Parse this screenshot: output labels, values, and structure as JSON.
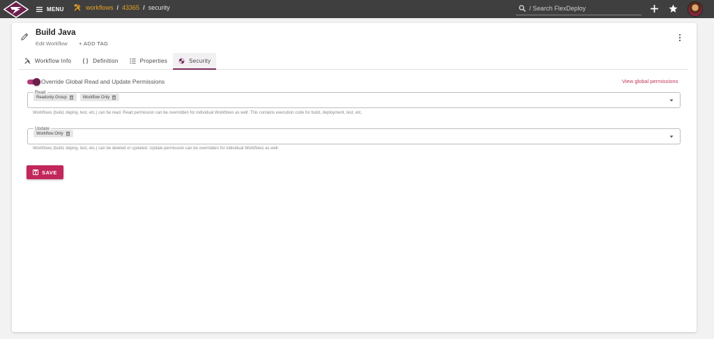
{
  "header": {
    "menu_label": "MENU",
    "breadcrumbs": [
      {
        "label": "workflows",
        "link": true
      },
      {
        "label": "43365",
        "link": true
      },
      {
        "label": "security",
        "link": false
      }
    ],
    "separator": "/",
    "search_placeholder": "/ Search FlexDeploy"
  },
  "page": {
    "title": "Build Java",
    "subtitle": "Edit Workflow",
    "add_tag_label": "+ ADD TAG"
  },
  "tabs": [
    {
      "label": "Workflow Info",
      "icon": "tools-icon"
    },
    {
      "label": "Definition",
      "icon": "braces-icon"
    },
    {
      "label": "Properties",
      "icon": "list-icon"
    },
    {
      "label": "Security",
      "icon": "shield-icon",
      "active": true
    }
  ],
  "security": {
    "override_label": "Override Global Read and Update Permissions",
    "override_enabled": true,
    "view_global_label": "View global permissions",
    "read": {
      "legend": "Read",
      "chips": [
        "Readonly Group",
        "Workflow Only"
      ],
      "hint": "Workflows (build, deploy, test, etc.) can be read. Read permission can be overridden for individual Workflows as well. This contains execution code for build, deployment, test, etc."
    },
    "update": {
      "legend": "Update",
      "chips": [
        "Workflow Only"
      ],
      "hint": "Workflows (build, deploy, test, etc.) can be deleted or updated. Update permission can be overridden for individual Workflows as well."
    }
  },
  "save_label": "SAVE",
  "colors": {
    "topbar": "#3f3f3f",
    "breadcrumb_link": "#e8a020",
    "accent": "#c1275a",
    "active_tab": "#7b2a5c"
  }
}
